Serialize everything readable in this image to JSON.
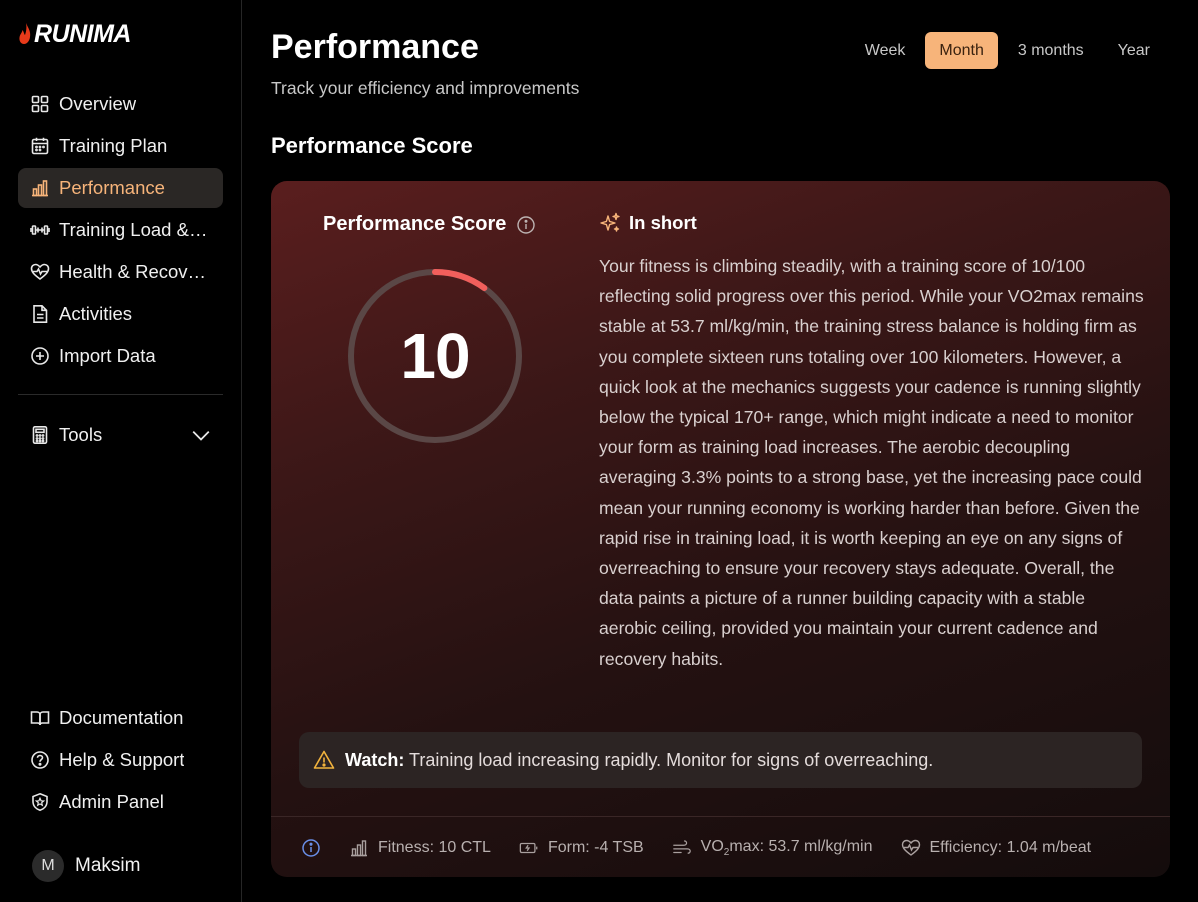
{
  "app": {
    "brand": "RUNIMA",
    "accent": "#f7b47a",
    "brand_color": "#e83a1a"
  },
  "sidebar": {
    "items": [
      {
        "label": "Overview",
        "icon": "grid-icon",
        "active": false
      },
      {
        "label": "Training Plan",
        "icon": "calendar-icon",
        "active": false
      },
      {
        "label": "Performance",
        "icon": "bar-chart-icon",
        "active": true
      },
      {
        "label": "Training Load & Recovery",
        "icon": "dumbbell-icon",
        "active": false
      },
      {
        "label": "Health & Recovery",
        "icon": "heart-pulse-icon",
        "active": false
      },
      {
        "label": "Activities",
        "icon": "document-icon",
        "active": false
      },
      {
        "label": "Import Data",
        "icon": "plus-circle-icon",
        "active": false
      }
    ],
    "tools": {
      "label": "Tools",
      "icon": "calculator-icon"
    },
    "bottom_items": [
      {
        "label": "Documentation",
        "icon": "book-icon"
      },
      {
        "label": "Help & Support",
        "icon": "question-circle-icon"
      },
      {
        "label": "Admin Panel",
        "icon": "shield-star-icon"
      }
    ],
    "user": {
      "initial": "M",
      "name": "Maksim"
    }
  },
  "header": {
    "title": "Performance",
    "subtitle": "Track your efficiency and improvements",
    "ranges": [
      {
        "label": "Week",
        "active": false
      },
      {
        "label": "Month",
        "active": true
      },
      {
        "label": "3 months",
        "active": false
      },
      {
        "label": "Year",
        "active": false
      }
    ]
  },
  "section": {
    "title": "Performance Score"
  },
  "card": {
    "score_label": "Performance Score",
    "score_value": "10",
    "score": 10,
    "score_max": 100,
    "inshort_title": "In short",
    "summary": "Your fitness is climbing steadily, with a training score of 10/100 reflecting solid progress over this period. While your VO2max remains stable at 53.7 ml/kg/min, the training stress balance is holding firm as you complete sixteen runs totaling over 100 kilometers. However, a quick look at the mechanics suggests your cadence is running slightly below the typical 170+ range, which might indicate a need to monitor your form as training load increases. The aerobic decoupling averaging 3.3% points to a strong base, yet the increasing pace could mean your running economy is working harder than before. Given the rapid rise in training load, it is worth keeping an eye on any signs of overreaching to ensure your recovery stays adequate. Overall, the data paints a picture of a runner building capacity with a stable aerobic ceiling, provided you maintain your current cadence and recovery habits.",
    "watch_label": "Watch:",
    "watch_text": "Training load increasing rapidly. Monitor for signs of overreaching.",
    "metrics": {
      "fitness": "Fitness: 10 CTL",
      "form": "Form: -4 TSB",
      "vo2_prefix": "VO",
      "vo2_sub": "2",
      "vo2_suffix": "max: 53.7 ml/kg/min",
      "efficiency": "Efficiency: 1.04 m/beat"
    }
  }
}
